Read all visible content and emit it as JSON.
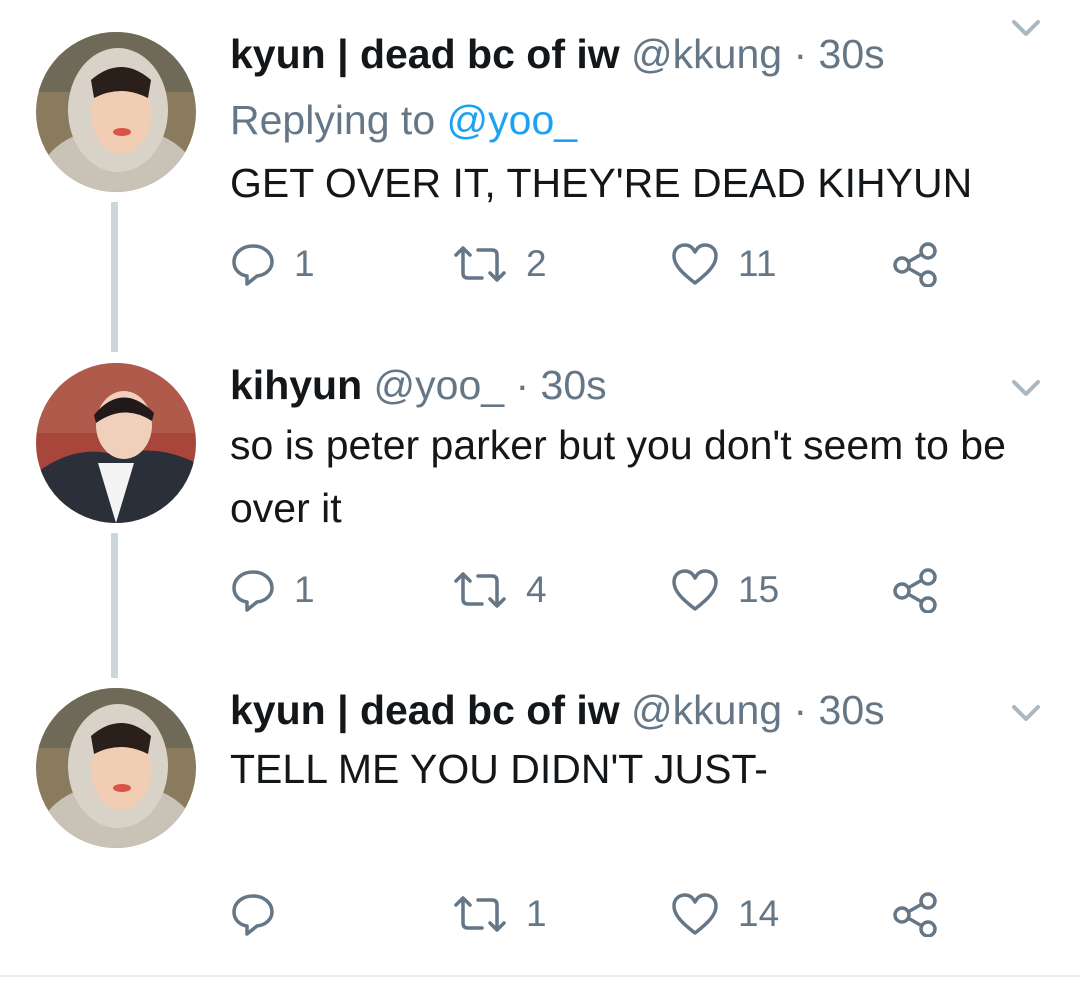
{
  "tweets": [
    {
      "name": "kyun | dead bc of iw",
      "handle": "@kkung",
      "separator": "·",
      "time": "30s",
      "replying_label": "Replying to",
      "replying_mention": "@yoo_",
      "text": "GET OVER IT, THEY'RE DEAD KIHYUN",
      "replies": "1",
      "retweets": "2",
      "likes": "11"
    },
    {
      "name": "kihyun",
      "handle": "@yoo_",
      "separator": "·",
      "time": "30s",
      "text": "so is peter parker but you don't seem to be over it",
      "replies": "1",
      "retweets": "4",
      "likes": "15"
    },
    {
      "name": "kyun | dead bc of iw",
      "handle": "@kkung",
      "separator": "·",
      "time": "30s",
      "text": "TELL ME YOU DIDN'T JUST-",
      "replies": "",
      "retweets": "1",
      "likes": "14"
    }
  ],
  "icons": {
    "reply": "reply-icon",
    "retweet": "retweet-icon",
    "like": "heart-icon",
    "share": "share-icon",
    "menu": "chevron-down-icon"
  },
  "colors": {
    "text": "#14171a",
    "secondary": "#657786",
    "mention": "#1da1f2",
    "thread_line": "#ccd6dd"
  }
}
